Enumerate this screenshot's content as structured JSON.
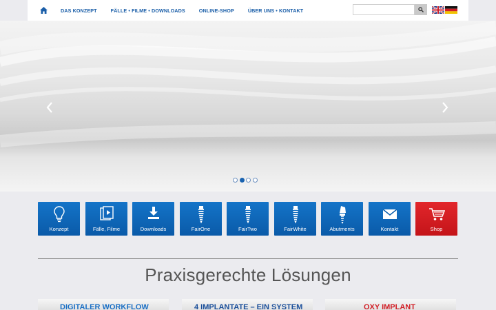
{
  "nav": {
    "home_icon": "home-icon",
    "items": [
      {
        "label": "DAS KONZEPT"
      },
      {
        "label": "FÄLLE • FILME • DOWNLOADS"
      },
      {
        "label": "ONLINE-SHOP"
      },
      {
        "label": "ÜBER UNS • KONTAKT"
      }
    ],
    "search": {
      "value": "",
      "placeholder": "",
      "icon": "search-icon"
    },
    "flags": [
      "uk-flag-icon",
      "germany-flag-icon"
    ]
  },
  "hero": {
    "slides_total": 4,
    "active_slide": 2,
    "prev_icon": "chevron-left-icon",
    "next_icon": "chevron-right-icon"
  },
  "tiles": [
    {
      "label": "Konzept",
      "icon": "lightbulb-icon"
    },
    {
      "label": "Fälle, Filme",
      "icon": "media-icon"
    },
    {
      "label": "Downloads",
      "icon": "download-icon"
    },
    {
      "label": "FairOne",
      "icon": "implant-icon"
    },
    {
      "label": "FairTwo",
      "icon": "implant-icon"
    },
    {
      "label": "FairWhite",
      "icon": "implant-icon"
    },
    {
      "label": "Abutments",
      "icon": "abutment-icon"
    },
    {
      "label": "Kontakt",
      "icon": "envelope-icon"
    },
    {
      "label": "Shop",
      "icon": "cart-icon"
    }
  ],
  "section": {
    "heading": "Praxisgerechte Lösungen"
  },
  "banners": [
    {
      "text": "DIGITALER WORKFLOW"
    },
    {
      "text": "4 IMPLANTATE – EIN SYSTEM"
    },
    {
      "text": "OXY IMPLANT"
    }
  ],
  "colors": {
    "brand_blue": "#0a5aa8",
    "nav_text": "#1a5ea8",
    "shop_red": "#c41419"
  }
}
